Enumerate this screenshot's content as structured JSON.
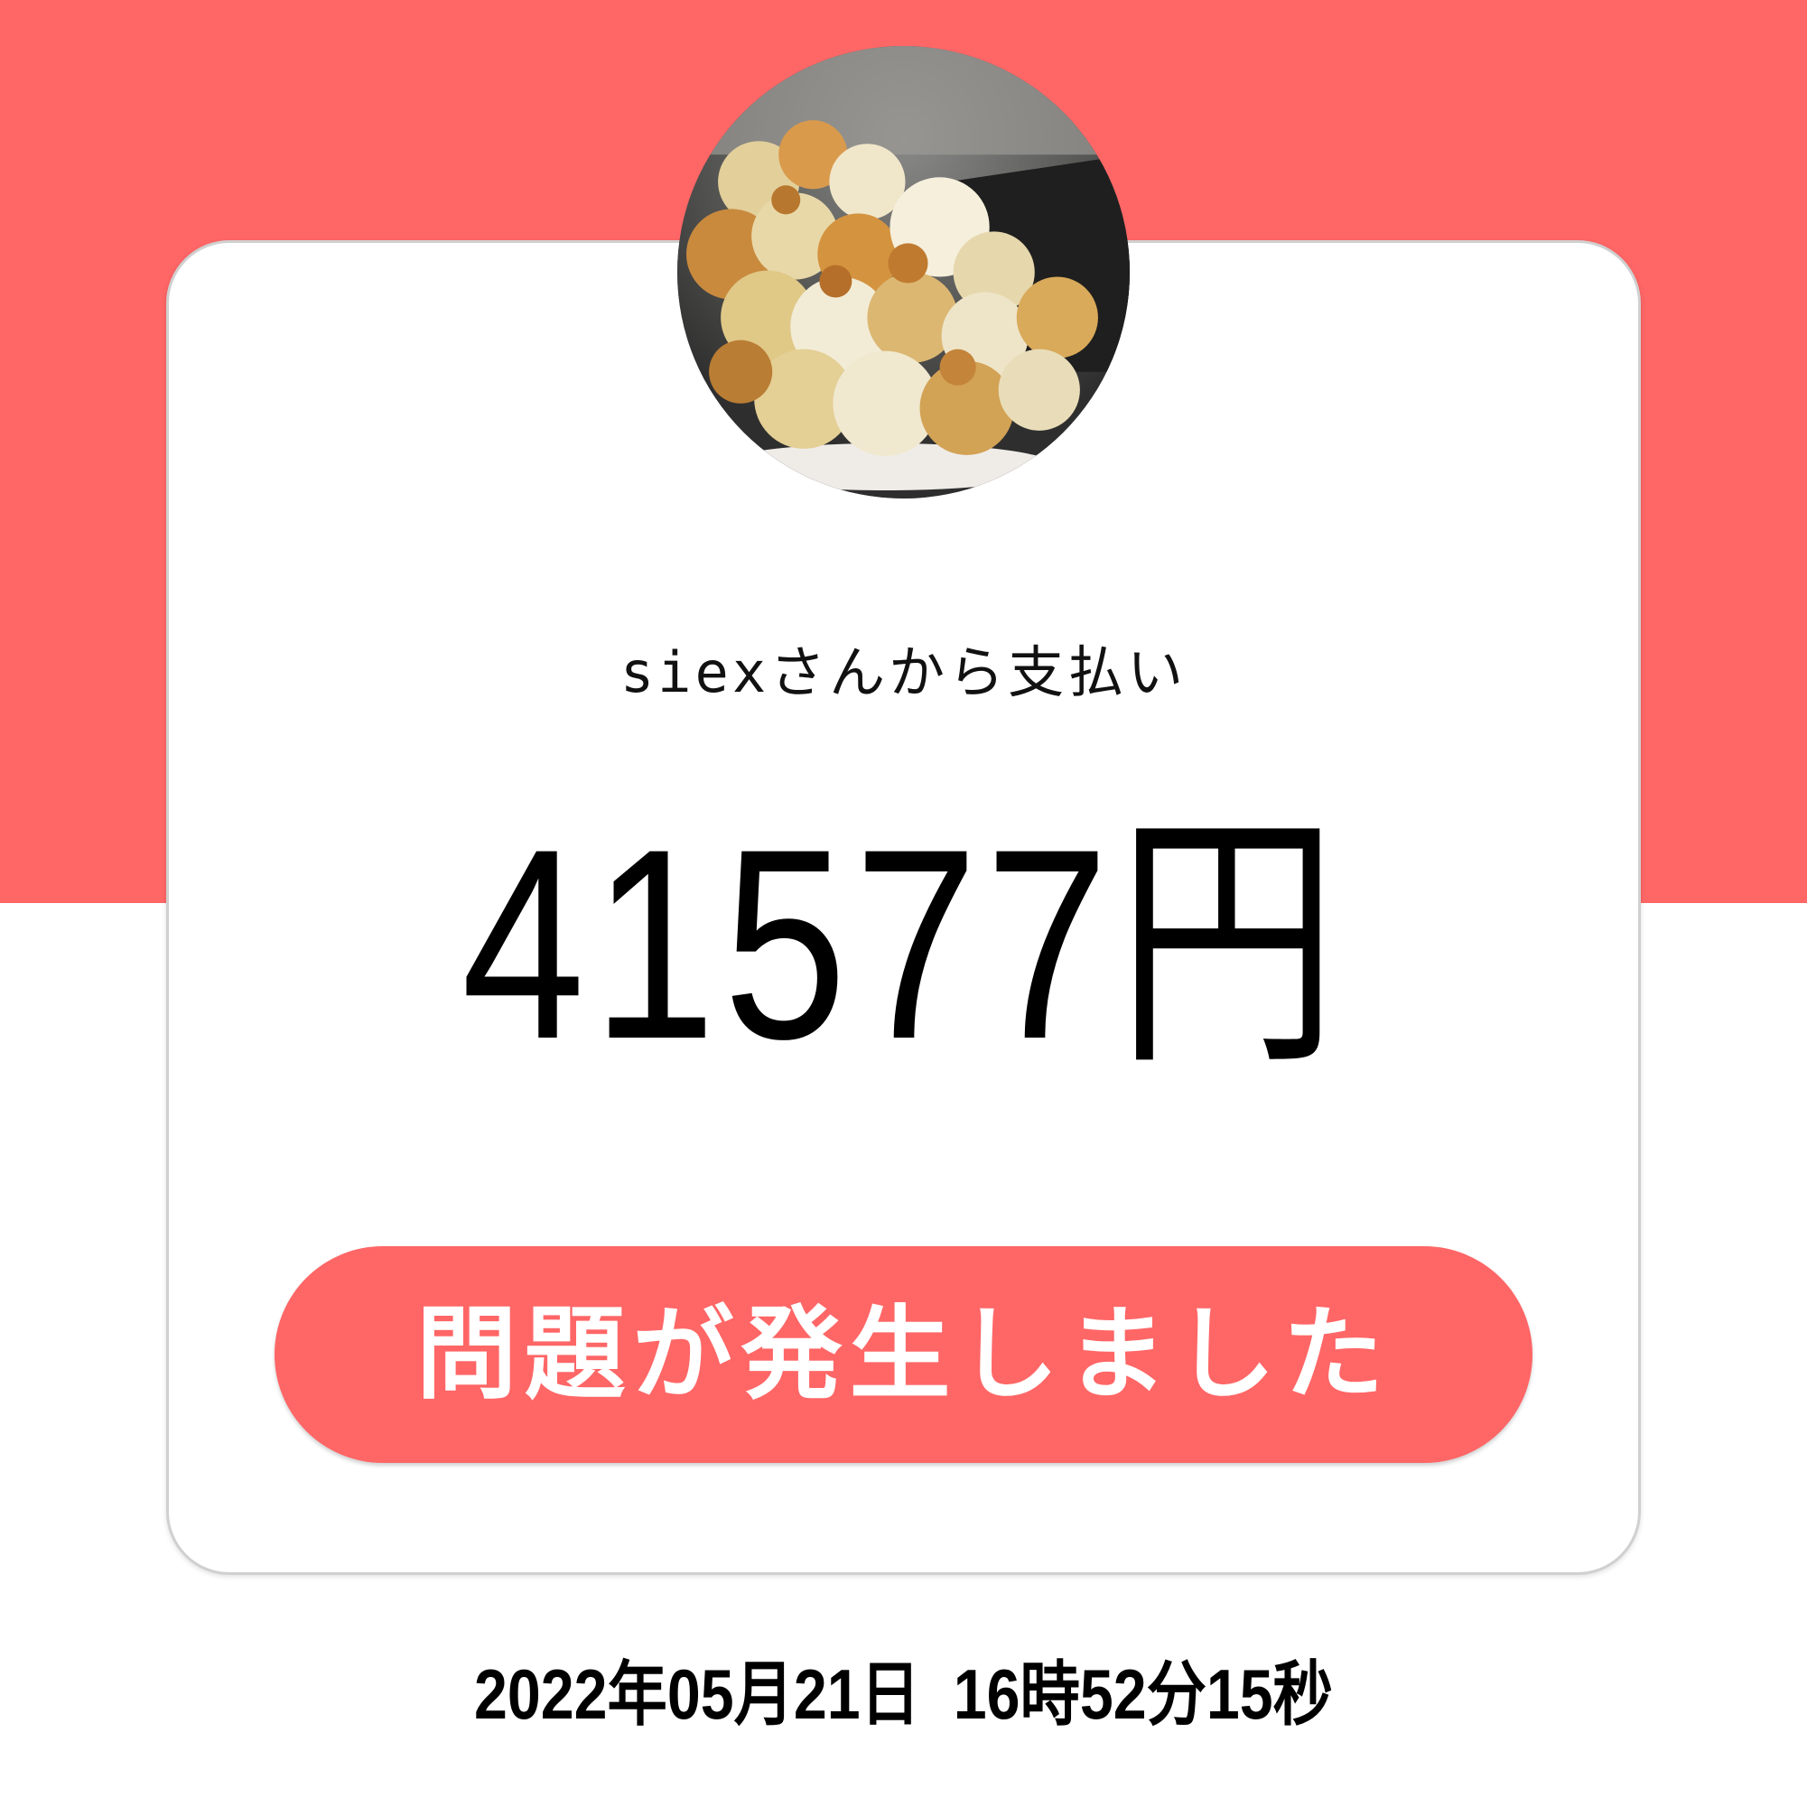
{
  "payment": {
    "payer_line": "siexさんから支払い",
    "amount": "41577円",
    "status_label": "問題が発生しました",
    "timestamp": "2022年05月21日  16時52分15秒"
  },
  "avatar": {
    "description_icon": "popcorn-photo"
  },
  "colors": {
    "accent": "#ff6666",
    "card_background": "#ffffff",
    "text": "#000000"
  }
}
